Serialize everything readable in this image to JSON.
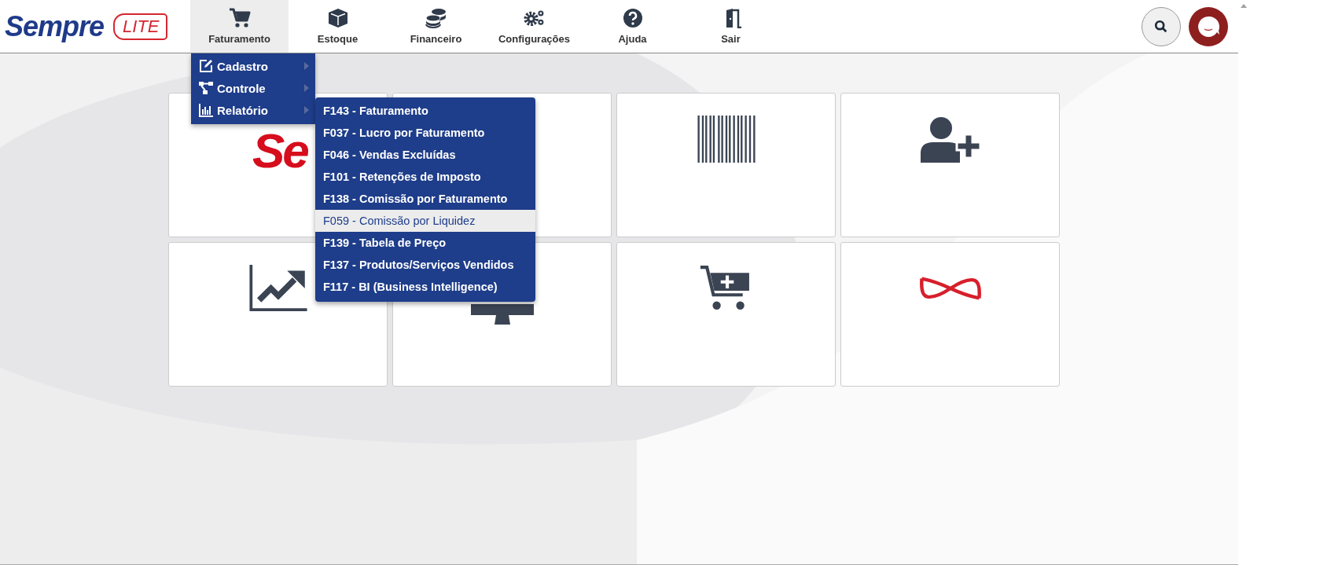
{
  "logo": {
    "brand": "Sempre",
    "badge": "LITE"
  },
  "nav": [
    {
      "label": "Faturamento",
      "selected": true
    },
    {
      "label": "Estoque",
      "selected": false
    },
    {
      "label": "Financeiro",
      "selected": false
    },
    {
      "label": "Configurações",
      "selected": false
    },
    {
      "label": "Ajuda",
      "selected": false
    },
    {
      "label": "Sair",
      "selected": false
    }
  ],
  "menu": [
    {
      "label": "Cadastro"
    },
    {
      "label": "Controle"
    },
    {
      "label": "Relatório"
    }
  ],
  "submenu": [
    {
      "label": "F143 - Faturamento",
      "selected": false
    },
    {
      "label": "F037 - Lucro por Faturamento",
      "selected": false
    },
    {
      "label": "F046 - Vendas Excluídas",
      "selected": false
    },
    {
      "label": "F101 - Retenções de Imposto",
      "selected": false
    },
    {
      "label": "F138 - Comissão por Faturamento",
      "selected": false
    },
    {
      "label": "F059 - Comissão por Liquidez",
      "selected": true
    },
    {
      "label": "F139 - Tabela de Preço",
      "selected": false
    },
    {
      "label": "F137 - Produtos/Serviços Vendidos",
      "selected": false
    },
    {
      "label": "F117 - BI (Business Intelligence)",
      "selected": false
    }
  ],
  "tiles": [
    {
      "kind": "logo",
      "text": "Se"
    },
    {
      "kind": "blank"
    },
    {
      "kind": "barcode"
    },
    {
      "kind": "user-add"
    },
    {
      "kind": "chart"
    },
    {
      "kind": "monitor"
    },
    {
      "kind": "cart-add"
    },
    {
      "kind": "infinity"
    }
  ]
}
